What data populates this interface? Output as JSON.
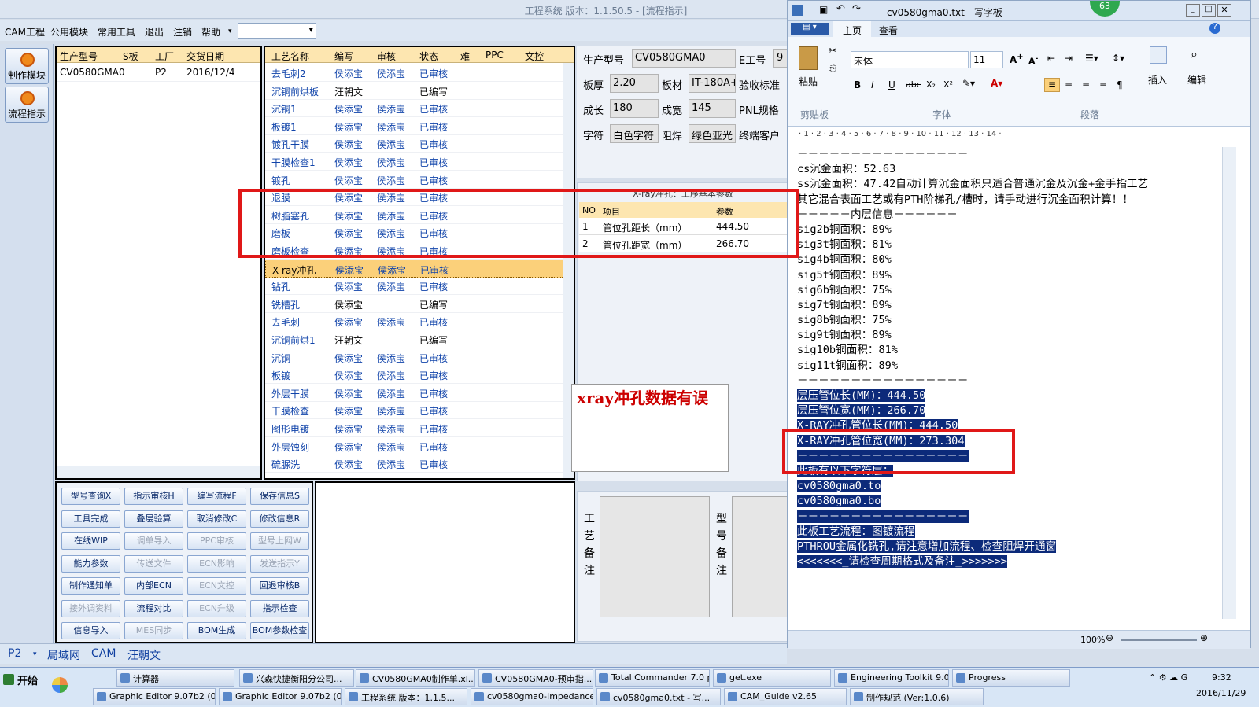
{
  "app": {
    "title": "工程系统  版本：1.1.50.5 - [流程指示]"
  },
  "menu": [
    "CAM工程",
    "公用模块",
    "常用工具",
    "退出",
    "注销",
    "帮助"
  ],
  "left_buttons": [
    "制作模块",
    "流程指示"
  ],
  "order_table": {
    "headers": [
      "生产型号",
      "S板",
      "工厂",
      "交货日期"
    ],
    "rows": [
      [
        "CV0580GMA0",
        "",
        "P2",
        "2016/12/4"
      ]
    ]
  },
  "process_table": {
    "headers": [
      "工艺名称",
      "编写",
      "审核",
      "状态",
      "难",
      "PPC",
      "文控"
    ],
    "rows": [
      [
        "去毛刺2",
        "侯添宝",
        "侯添宝",
        "已审核"
      ],
      [
        "沉铜前烘板",
        "汪朝文",
        "",
        "已编写"
      ],
      [
        "沉铜1",
        "侯添宝",
        "侯添宝",
        "已审核"
      ],
      [
        "板镀1",
        "侯添宝",
        "侯添宝",
        "已审核"
      ],
      [
        "镀孔干膜",
        "侯添宝",
        "侯添宝",
        "已审核"
      ],
      [
        "干膜检查1",
        "侯添宝",
        "侯添宝",
        "已审核"
      ],
      [
        "镀孔",
        "侯添宝",
        "侯添宝",
        "已审核"
      ],
      [
        "退膜",
        "侯添宝",
        "侯添宝",
        "已审核"
      ],
      [
        "树脂塞孔",
        "侯添宝",
        "侯添宝",
        "已审核"
      ],
      [
        "磨板",
        "侯添宝",
        "侯添宝",
        "已审核"
      ],
      [
        "磨板检查",
        "侯添宝",
        "侯添宝",
        "已审核"
      ],
      [
        "X-ray冲孔",
        "侯添宝",
        "侯添宝",
        "已审核"
      ],
      [
        "钻孔",
        "侯添宝",
        "侯添宝",
        "已审核"
      ],
      [
        "铣槽孔",
        "侯添宝",
        "",
        "已编写"
      ],
      [
        "去毛刺",
        "侯添宝",
        "侯添宝",
        "已审核"
      ],
      [
        "沉铜前烘1",
        "汪朝文",
        "",
        "已编写"
      ],
      [
        "沉铜",
        "侯添宝",
        "侯添宝",
        "已审核"
      ],
      [
        "板镀",
        "侯添宝",
        "侯添宝",
        "已审核"
      ],
      [
        "外层干膜",
        "侯添宝",
        "侯添宝",
        "已审核"
      ],
      [
        "干膜检查",
        "侯添宝",
        "侯添宝",
        "已审核"
      ],
      [
        "图形电镀",
        "侯添宝",
        "侯添宝",
        "已审核"
      ],
      [
        "外层蚀刻",
        "侯添宝",
        "侯添宝",
        "已审核"
      ],
      [
        "硫脲洗",
        "侯添宝",
        "侯添宝",
        "已审核"
      ]
    ],
    "selected_index": 11
  },
  "action_buttons": [
    [
      "型号查询X",
      "指示审核H",
      "编写流程F",
      "保存信息S"
    ],
    [
      "工具完成",
      "叠层验算",
      "取消修改C",
      "修改信息R"
    ],
    [
      "在线WIP",
      "调单导入",
      "PPC审核",
      "型号上网W"
    ],
    [
      "能力参数",
      "传送文件",
      "ECN影响",
      "发送指示Y"
    ],
    [
      "制作通知单",
      "内部ECN",
      "ECN文控",
      "回退审核B"
    ],
    [
      "接外调资料",
      "流程对比",
      "ECN升级",
      "指示检查"
    ],
    [
      "信息导入",
      "MES同步",
      "BOM生成",
      "BOM参数检查"
    ]
  ],
  "disabled_buttons": [
    "调单导入",
    "PPC审核",
    "型号上网W",
    "传送文件",
    "ECN影响",
    "发送指示Y",
    "ECN文控",
    "接外调资料",
    "ECN升级",
    "MES同步"
  ],
  "info": {
    "model_label": "生产型号",
    "model": "CV0580GMA0",
    "e_label": "E工号",
    "e_val": "9",
    "thick_label": "板厚",
    "thick": "2.20",
    "mat_label": "板材",
    "mat": "IT-180A+",
    "accept_label": "验收标准",
    "len_label": "成长",
    "len": "180",
    "wid_label": "成宽",
    "wid": "145",
    "pnl_label": "PNL规格",
    "char_label": "字符",
    "char": "白色字符",
    "mask_label": "阻焊",
    "mask": "绿色亚光",
    "cust_label": "终端客户"
  },
  "xray": {
    "title": "X-ray冲孔：工序基本参数",
    "headers": [
      "NO",
      "项目",
      "参数"
    ],
    "rows": [
      [
        "1",
        "管位孔距长（mm）",
        "444.50"
      ],
      [
        "2",
        "管位孔距宽（mm）",
        "266.70"
      ]
    ]
  },
  "remark_labels": {
    "process": "工艺备注",
    "model": "型号备注"
  },
  "annotation": "xray冲孔数据有误",
  "tabs": [
    "P2",
    "局域网",
    "CAM",
    "汪朝文"
  ],
  "wordpad": {
    "title": "cv0580gma0.txt - 写字板",
    "badge": "63",
    "ribbon_tabs": [
      "主页",
      "查看"
    ],
    "font": "宋体",
    "size": "11",
    "groups": [
      "剪贴板",
      "字体",
      "段落"
    ],
    "paste": "粘贴",
    "insert": "插入",
    "edit": "编辑",
    "zoom": "100%",
    "ruler": "· 1 · 2 · 3 · 4 · 5 · 6 · 7 · 8 · 9 · 10 · 11 · 12 · 13 · 14 ·",
    "lines": [
      "－－－－－－－－－－－－－－－－",
      "cs沉金面积：52.63",
      "ss沉金面积：47.42自动计算沉金面积只适合普通沉金及沉金+金手指工艺",
      "其它混合表面工艺或有PTH阶梯孔/槽时，请手动进行沉金面积计算！！",
      "－－－－－内层信息－－－－－－",
      "sig2b铜面积：89%",
      "sig3t铜面积：81%",
      "sig4b铜面积：80%",
      "sig5t铜面积：89%",
      "sig6b铜面积：75%",
      "sig7t铜面积：89%",
      "sig8b铜面积：75%",
      "sig9t铜面积：89%",
      "sig10b铜面积：81%",
      "sig11t铜面积：89%",
      "－－－－－－－－－－－－－－－－",
      "层压管位长(MM)：444.50",
      "层压管位宽(MM)：266.70",
      "X-RAY冲孔管位长(MM)：444.50",
      "X-RAY冲孔管位宽(MM)：273.304",
      "－－－－－－－－－－－－－－－－",
      "此板有以下字符层：",
      "cv0580gma0.to",
      "cv0580gma0.bo",
      "－－－－－－－－－－－－－－－－",
      "此板工艺流程：图镀流程",
      "PTHROU金属化铣孔,请注意增加流程、检查阻焊开通窗",
      "<<<<<<<_请检查周期格式及备注_>>>>>>>"
    ],
    "highlight_from": 16
  },
  "taskbar": {
    "start": "开始",
    "row1": [
      "计算器",
      "兴森快捷衡阳分公司...",
      "CV0580GMA0制作单.xl...",
      "CV0580GMA0-预审指...",
      "Total Commander 7.0 p...",
      "get.exe",
      "Engineering Toolkit 9.0...",
      "Progress"
    ],
    "row2": [
      "Graphic Editor 9.07b2 (0...",
      "Graphic Editor 9.07b2 (0...",
      "工程系统 版本：1.1.5...",
      "cv0580gma0-Impedance...",
      "cv0580gma0.txt - 写...",
      "CAM_Guide v2.65",
      "制作规范 (Ver:1.0.6)"
    ],
    "time": "9:32",
    "date": "2016/11/29"
  }
}
